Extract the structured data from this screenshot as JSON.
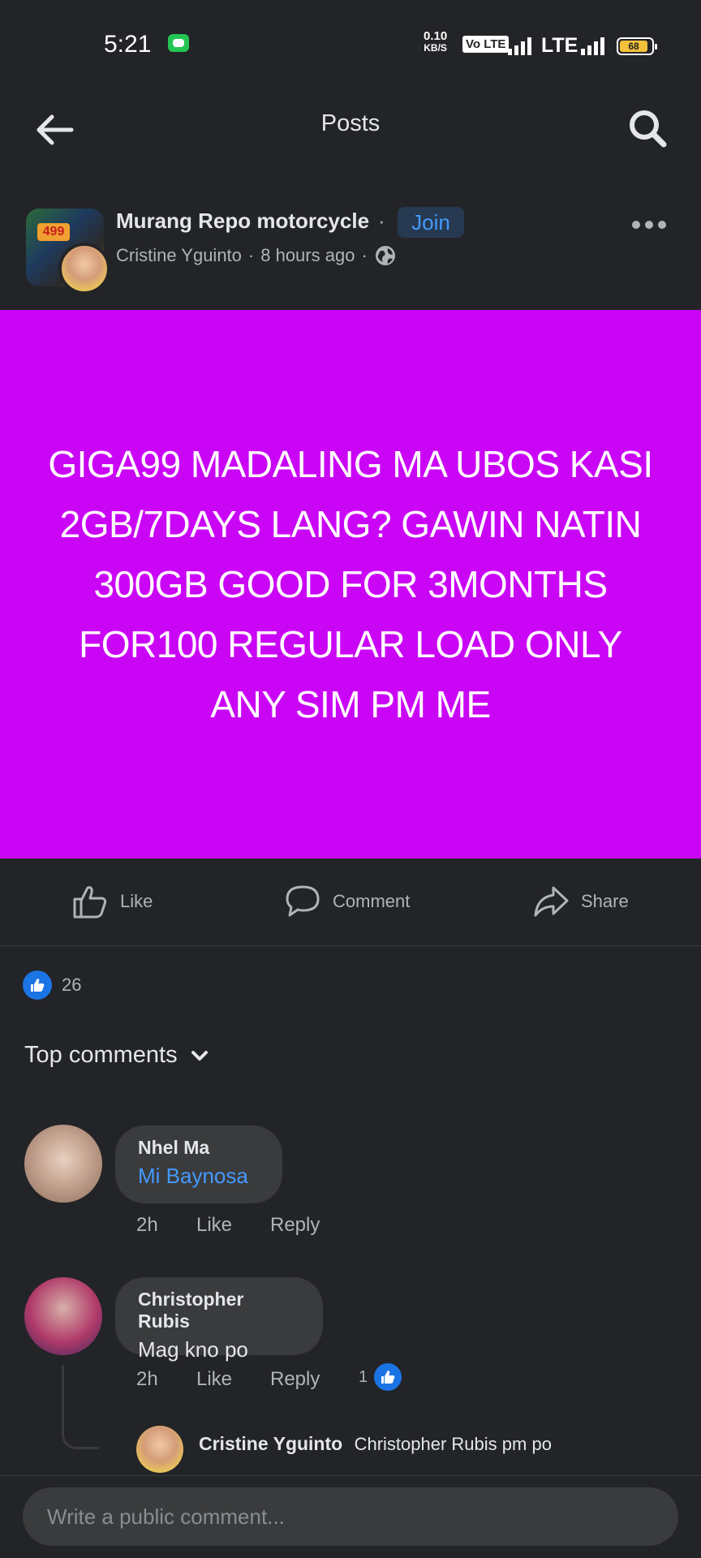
{
  "status_bar": {
    "time": "5:21",
    "net_speed_value": "0.10",
    "net_speed_unit": "KB/S",
    "volte": "Vo LTE",
    "lte": "LTE",
    "battery": "68"
  },
  "topbar": {
    "title": "Posts",
    "back_icon": "arrow-left-icon",
    "search_icon": "search-icon"
  },
  "post": {
    "group_name": "Murang Repo motorcycle",
    "group_dot": "·",
    "join_label": "Join",
    "author": "Cristine Yguinto",
    "time": "8 hours ago",
    "meta_sep": "·",
    "privacy_icon": "globe-icon",
    "banner_color": "#ca05f6",
    "text": "GIGA99 MADALING MA UBOS KASI 2GB/7DAYS LANG? GAWIN NATIN 300GB GOOD FOR 3MONTHS FOR100 REGULAR LOAD ONLY ANY SIM PM ME"
  },
  "actions": {
    "like": "Like",
    "comment": "Comment",
    "share": "Share"
  },
  "reactions": {
    "count": "26"
  },
  "comments_header": {
    "label": "Top comments"
  },
  "comments": [
    {
      "name": "Nhel Ma",
      "text": "Mi Baynosa",
      "time": "2h",
      "like": "Like",
      "reply": "Reply"
    },
    {
      "name": "Christopher Rubis",
      "text": "Mag kno po",
      "time": "2h",
      "like": "Like",
      "reply": "Reply",
      "reaction_count": "1",
      "reply_preview": {
        "name": "Cristine Yguinto",
        "text": "Christopher Rubis pm po"
      }
    }
  ],
  "composer": {
    "placeholder": "Write a public comment..."
  },
  "colors": {
    "background": "#232427",
    "accent": "#4599ff",
    "like_blue": "#1b74e4"
  }
}
